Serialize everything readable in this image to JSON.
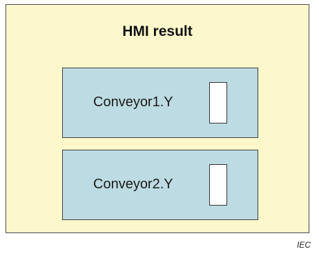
{
  "colors": {
    "panel_background": "#fcf8cc",
    "conveyor_background": "#bddbe2"
  },
  "hmi": {
    "title": "HMI result",
    "conveyors": [
      {
        "label": "Conveyor1.Y"
      },
      {
        "label": "Conveyor2.Y"
      }
    ]
  },
  "footer": {
    "tag": "IEC"
  }
}
